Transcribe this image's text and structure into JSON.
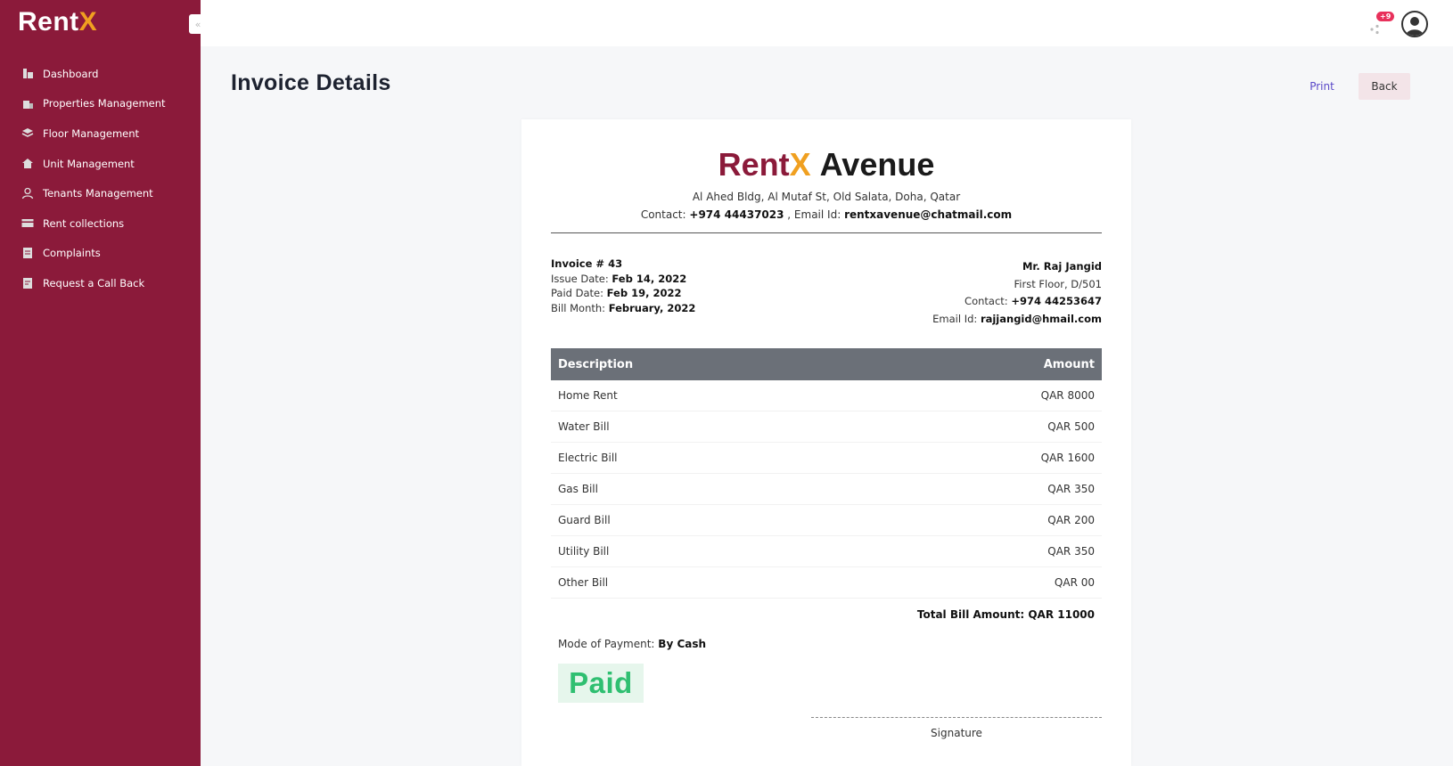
{
  "app": {
    "logo_text": "Rent",
    "logo_accent": "X",
    "collapse_icon": "«"
  },
  "sidebar": {
    "items": [
      {
        "label": "Dashboard",
        "icon": "dashboard-icon"
      },
      {
        "label": "Properties Management",
        "icon": "building-icon"
      },
      {
        "label": "Floor Management",
        "icon": "layers-icon"
      },
      {
        "label": "Unit Management",
        "icon": "home-icon"
      },
      {
        "label": "Tenants Management",
        "icon": "user-icon"
      },
      {
        "label": "Rent collections",
        "icon": "card-icon"
      },
      {
        "label": "Complaints",
        "icon": "document-icon"
      },
      {
        "label": "Request a Call Back",
        "icon": "phone-document-icon"
      }
    ]
  },
  "topbar": {
    "notification_count": "+9"
  },
  "page": {
    "title": "Invoice Details",
    "print_label": "Print",
    "back_label": "Back"
  },
  "invoice": {
    "brand_rent": "Rent",
    "brand_x": "X",
    "brand_name": "Avenue",
    "address": "Al Ahed Bldg, Al Mutaf St, Old Salata, Doha, Qatar",
    "contact_label": "Contact:",
    "contact_value": "+974 44437023",
    "email_label": ", Email Id:",
    "email_value": "rentxavenue@chatmail.com",
    "number_label": "Invoice # 43",
    "issue_label": "Issue Date:",
    "issue_value": "Feb 14, 2022",
    "paid_label": "Paid Date:",
    "paid_value": "Feb 19, 2022",
    "bill_month_label": "Bill Month:",
    "bill_month_value": "February, 2022",
    "tenant_name": "Mr. Raj Jangid",
    "tenant_address": "First Floor, D/501",
    "tenant_contact_label": "Contact:",
    "tenant_contact_value": "+974 44253647",
    "tenant_email_label": "Email Id:",
    "tenant_email_value": "rajjangid@hmail.com",
    "table": {
      "header_description": "Description",
      "header_amount": "Amount",
      "rows": [
        {
          "description": "Home Rent",
          "amount": "QAR 8000"
        },
        {
          "description": "Water Bill",
          "amount": "QAR 500"
        },
        {
          "description": "Electric Bill",
          "amount": "QAR 1600"
        },
        {
          "description": "Gas Bill",
          "amount": "QAR 350"
        },
        {
          "description": "Guard Bill",
          "amount": "QAR 200"
        },
        {
          "description": "Utility Bill",
          "amount": "QAR 350"
        },
        {
          "description": "Other Bill",
          "amount": "QAR 00"
        }
      ],
      "total": "Total Bill Amount: QAR 11000"
    },
    "mode_label": "Mode of Payment:",
    "mode_value": "By Cash",
    "status": "Paid",
    "signature_label": "Signature"
  },
  "colors": {
    "sidebar": "#8b1a3a",
    "accent": "#f0a020",
    "paid_green": "#2fbf71",
    "table_header": "#6b7078"
  }
}
